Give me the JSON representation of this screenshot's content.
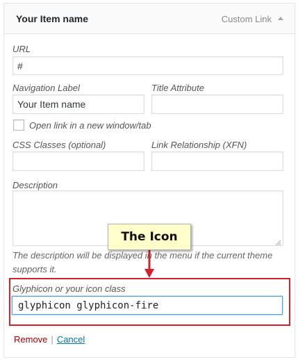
{
  "header": {
    "item_title": "Your Item name",
    "item_type": "Custom Link",
    "toggle_icon": "triangle-up-icon"
  },
  "fields": {
    "url": {
      "label": "URL",
      "value": "#"
    },
    "navigation_label": {
      "label": "Navigation Label",
      "value": "Your Item name"
    },
    "title_attribute": {
      "label": "Title Attribute",
      "value": ""
    },
    "open_new_window": {
      "label": "Open link in a new window/tab",
      "checked": false
    },
    "css_classes": {
      "label": "CSS Classes (optional)",
      "value": ""
    },
    "link_relationship": {
      "label": "Link Relationship (XFN)",
      "value": ""
    },
    "description": {
      "label": "Description",
      "value": "",
      "note": "The description will be displayed in the menu if the current theme supports it."
    },
    "icon_class": {
      "label": "Glyphicon or your icon class",
      "value": "glyphicon glyphicon-fire"
    }
  },
  "callout": {
    "text": "The Icon"
  },
  "actions": {
    "remove": "Remove",
    "separator": "|",
    "cancel": "Cancel"
  },
  "colors": {
    "highlight": "#d51f2a",
    "callout_bg": "#ffffcc",
    "link": "#0073aa",
    "remove": "#aa0000"
  }
}
